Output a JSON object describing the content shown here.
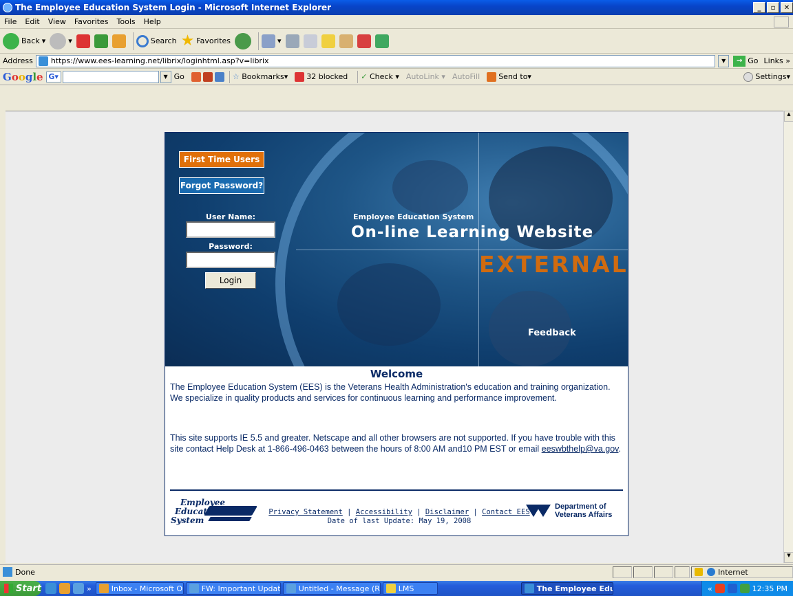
{
  "window": {
    "title": "The Employee Education System Login - Microsoft Internet Explorer",
    "min": "_",
    "max": "▫",
    "close": "✕"
  },
  "menu": [
    "File",
    "Edit",
    "View",
    "Favorites",
    "Tools",
    "Help"
  ],
  "toolbar": {
    "back": "Back",
    "search": "Search",
    "favorites": "Favorites"
  },
  "address": {
    "label": "Address",
    "url": "https://www.ees-learning.net/librix/loginhtml.asp?v=librix",
    "go": "Go",
    "links": "Links »"
  },
  "google": {
    "logo": "Google",
    "go": "Go",
    "bookmarks": "Bookmarks▾",
    "blocked": "32 blocked",
    "check": "Check ▾",
    "autolink": "AutoLink ▾",
    "autofill": "AutoFill",
    "sendto": "Send to▾",
    "settings": "Settings▾"
  },
  "login": {
    "first_time": "First Time Users",
    "forgot": "Forgot Password?",
    "username_label": "User Name:",
    "password_label": "Password:",
    "username_value": "",
    "password_value": "",
    "login_button": "Login"
  },
  "hero": {
    "subtitle": "Employee Education System",
    "title": "On-line Learning Website",
    "external": "EXTERNAL",
    "feedback": "Feedback"
  },
  "welcome": {
    "heading": "Welcome",
    "para1": "The Employee Education System (EES) is the Veterans Health Administration's education and training organization. We specialize in quality products and services for continuous learning and performance improvement.",
    "para2_text": "This site supports IE 5.5 and greater. Netscape and all other browsers are not supported. If you have trouble with this site contact Help Desk at 1-866-496-0463 between the hours of 8:00 AM and10 PM EST or email ",
    "email": "eeswbthelp@va.gov",
    "para2_end": "."
  },
  "footer": {
    "logo_line1": "Employee",
    "logo_line2": "Education",
    "logo_line3": "System",
    "privacy": "Privacy Statement",
    "accessibility": "Accessibility",
    "disclaimer": "Disclaimer",
    "contact": "Contact EES",
    "sep": " | ",
    "updated": "Date of last Update: May 19, 2008",
    "va_line1": "Department of",
    "va_line2": "Veterans Affairs"
  },
  "status": {
    "text": "Done",
    "zone": "Internet"
  },
  "taskbar": {
    "start": "Start",
    "chev": "»",
    "tasks": [
      "Inbox - Microsoft Out...",
      "FW: Important Updat...",
      "Untitled - Message (Ri...",
      "LMS",
      "The Employee Educ..."
    ],
    "tray_chev": "«",
    "clock": "12:35 PM"
  },
  "colors": {
    "navy": "#0a2a66",
    "orange": "#e0700a",
    "blue_btn": "#1a6bb0",
    "external": "#d06b10"
  }
}
